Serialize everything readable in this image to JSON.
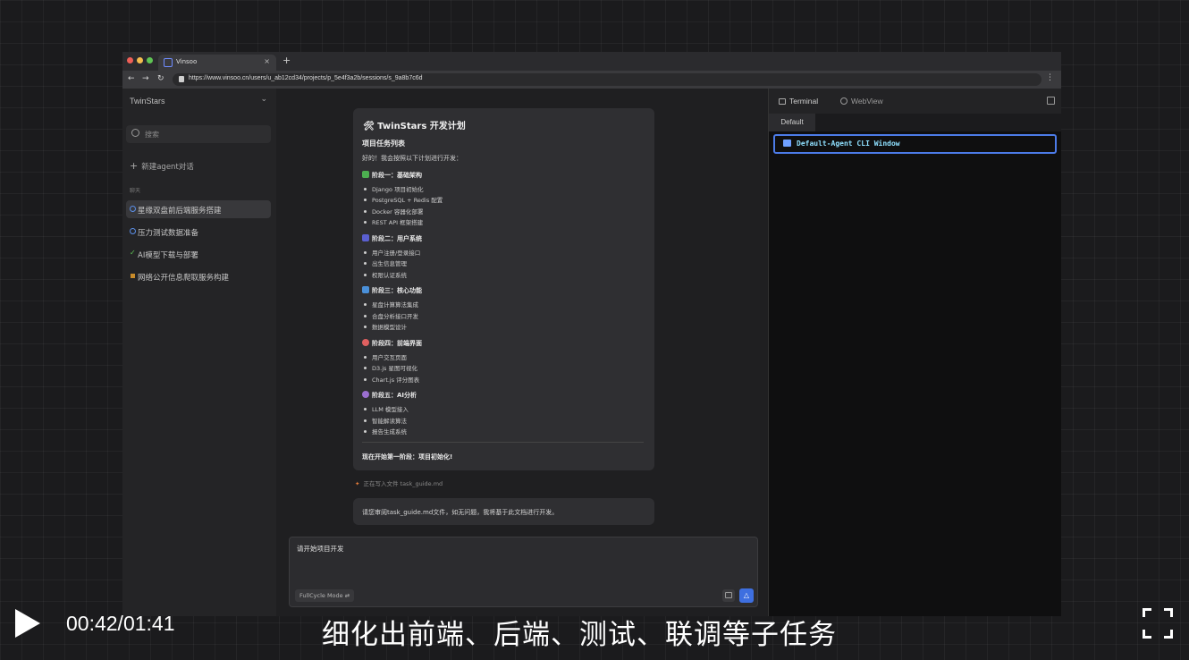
{
  "browser": {
    "tab_title": "Vinsoo",
    "tab_close": "×",
    "new_tab": "+",
    "url": "https://www.vinsoo.cn/users/u_ab12cd34/projects/p_5e4f3a2b/sessions/s_9a8b7c6d",
    "nav": {
      "back": "←",
      "forward": "→",
      "reload": "↻",
      "menu": "⋮"
    }
  },
  "sidebar": {
    "workspace": "TwinStars",
    "chevron": "⌄",
    "search_placeholder": "搜索",
    "new_agent": "新建agent对话",
    "plus": "+",
    "section_label": "聊天",
    "items": [
      {
        "label": "星缘双盘前后端服务搭建",
        "icon": "ring-icon",
        "color": "#5b8fe8"
      },
      {
        "label": "压力测试数据准备",
        "icon": "ring-icon",
        "color": "#5b8fe8"
      },
      {
        "label": "AI模型下载与部署",
        "icon": "check-icon",
        "color": "#5fc454"
      },
      {
        "label": "网络公开信息爬取服务构建",
        "icon": "square-icon",
        "color": "#c98c2a"
      }
    ]
  },
  "chat": {
    "plan": {
      "title": "🛠 TwinStars 开发计划",
      "subtitle": "项目任务列表",
      "intro": "好的！我会按照以下计划进行开发：",
      "phases": [
        {
          "title": "阶段一：基础架构",
          "icon_color": "#4caf50",
          "items": [
            "Django 项目初始化",
            "PostgreSQL + Redis 配置",
            "Docker 容器化部署",
            "REST API 框架搭建"
          ]
        },
        {
          "title": "阶段二：用户系统",
          "icon_color": "#5a5fd0",
          "items": [
            "用户注册/登录接口",
            "出生信息管理",
            "权限认证系统"
          ]
        },
        {
          "title": "阶段三：核心功能",
          "icon_color": "#4a90d9",
          "items": [
            "星盘计算算法集成",
            "合盘分析接口开发",
            "数据模型设计"
          ]
        },
        {
          "title": "阶段四：前端界面",
          "icon_color": "#e06060",
          "items": [
            "用户交互页面",
            "D3.js 星图可视化",
            "Chart.js 评分图表"
          ]
        },
        {
          "title": "阶段五：AI分析",
          "icon_color": "#9b6fd0",
          "items": [
            "LLM 模型接入",
            "智能解读算法",
            "报告生成系统"
          ]
        }
      ],
      "footer": "现在开始第一阶段：项目初始化!"
    },
    "writing_status": "正在写入文件 task_guide.md",
    "spark": "✦",
    "review_message": "请您审阅task_guide.md文件，如无问题，我将基于此文档进行开发。",
    "composer": {
      "text": "请开始项目开发",
      "mode_label": "FullCycle Mode ⇄",
      "send": "△"
    }
  },
  "terminal": {
    "tab_terminal": "Terminal",
    "tab_webview": "WebView",
    "subtab": "Default",
    "cli_window": "Default-Agent CLI Window"
  },
  "player": {
    "time": "00:42/01:41",
    "subtitle": "细化出前端、后端、测试、联调等子任务"
  }
}
